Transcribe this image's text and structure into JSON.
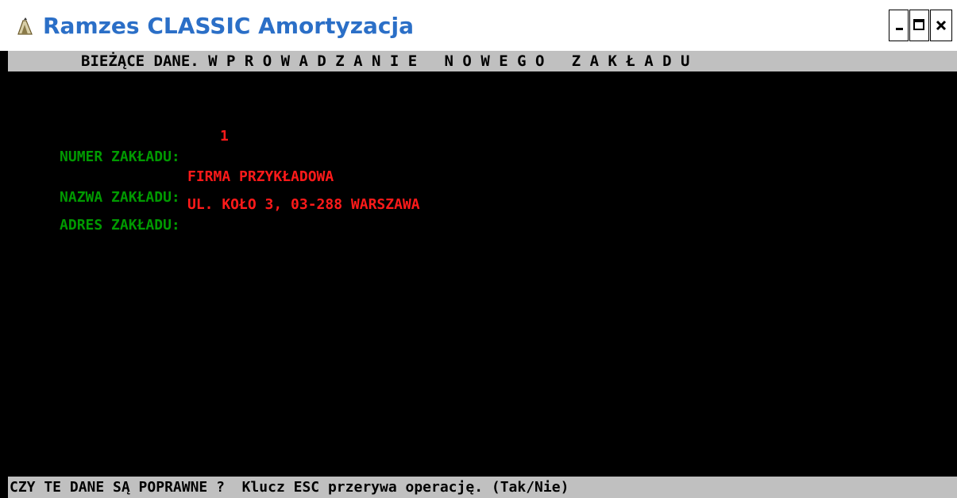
{
  "window": {
    "title": "Ramzes CLASSIC Amortyzacja",
    "title_color": "#2b6fc7",
    "icon": "app-icon",
    "controls": [
      "minimize-icon",
      "maximize-icon",
      "close-icon"
    ]
  },
  "console": {
    "header": "BIEŻĄCE DANE. W P R O W A D Z A N I E   N O W E G O   Z A K Ł A D U",
    "fields": [
      {
        "label": "NUMER ZAKŁADU:",
        "value": "1"
      },
      {
        "label": "NAZWA ZAKŁADU:",
        "value": "FIRMA PRZYKŁADOWA"
      },
      {
        "label": "ADRES ZAKŁADU:",
        "value": "UL. KOŁO 3, 03-288 WARSZAWA"
      }
    ],
    "status": "CZY TE DANE SĄ POPRAWNE ?  Klucz ESC przerywa operację. (Tak/Nie)",
    "colors": {
      "background": "#000000",
      "bar": "#c0c0c0",
      "label": "#009a00",
      "value": "#ff1a1a"
    }
  }
}
